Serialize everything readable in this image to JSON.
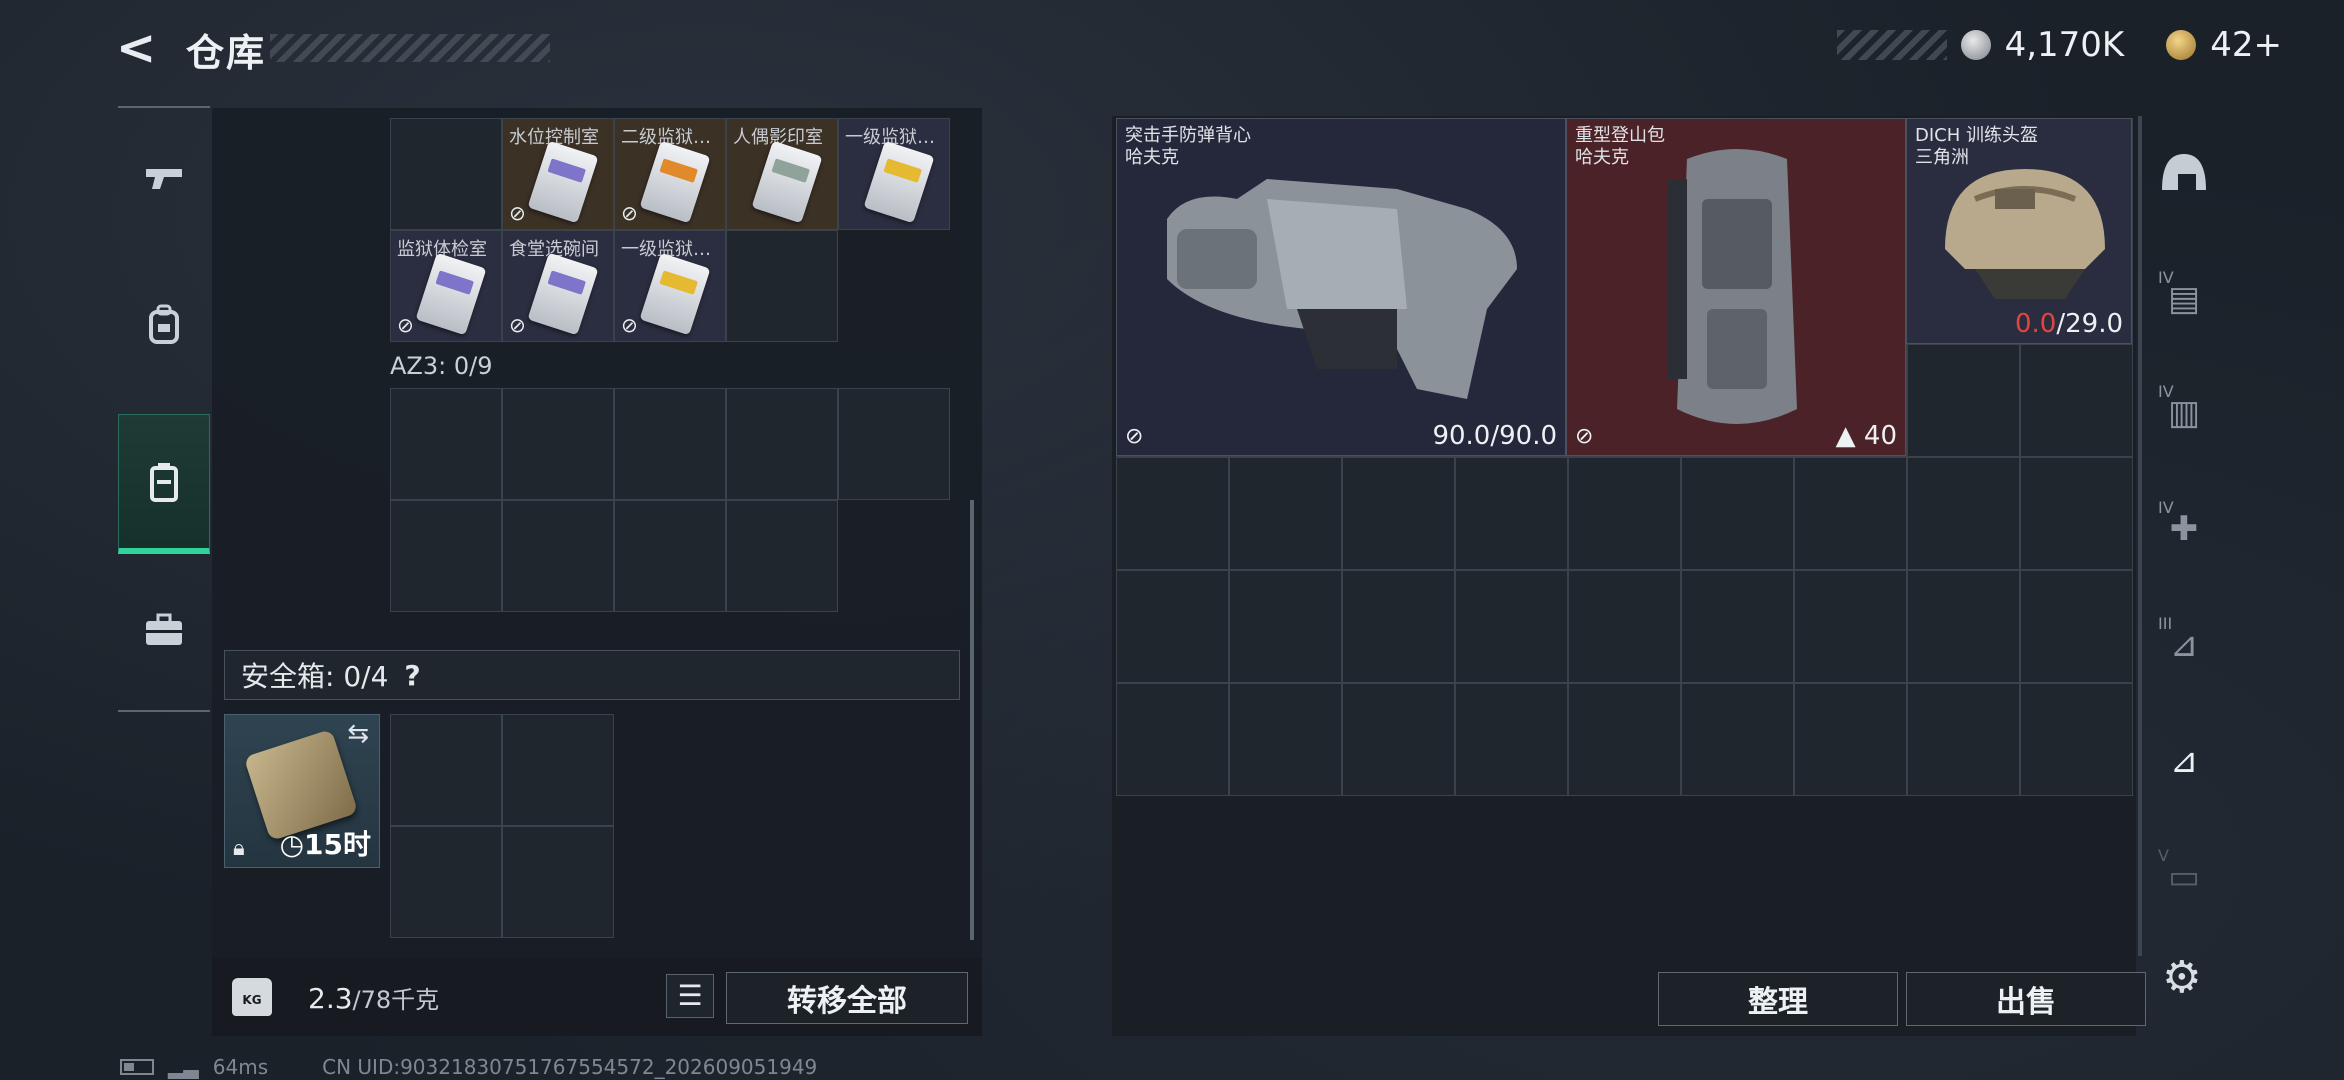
{
  "header": {
    "back_icon": "back-arrow-icon",
    "title": "仓库",
    "currency": [
      {
        "icon": "silver-coin-icon",
        "value": "4,170K"
      },
      {
        "icon": "gold-coin-icon",
        "value": "42+"
      }
    ]
  },
  "left_nav": [
    {
      "icon": "gun-icon",
      "glyph": "⌐"
    },
    {
      "icon": "backpack-icon",
      "glyph": "♜"
    },
    {
      "icon": "vest-icon",
      "glyph": "▣",
      "active": true
    },
    {
      "icon": "briefcase-icon",
      "glyph": "⬓"
    }
  ],
  "keycards": [
    {
      "label": "",
      "color": "none",
      "bg": "empty"
    },
    {
      "label": "水位控制室",
      "color": "purple",
      "bg": "brown"
    },
    {
      "label": "二级监狱…",
      "color": "orange",
      "bg": "brown"
    },
    {
      "label": "人偶影印室",
      "color": "green",
      "bg": "brown"
    },
    {
      "label": "一级监狱…",
      "color": "gold",
      "bg": "navy"
    },
    {
      "label": "监狱体检室",
      "color": "purple",
      "bg": "navy"
    },
    {
      "label": "食堂选碗间",
      "color": "purple",
      "bg": "navy"
    },
    {
      "label": "一级监狱…",
      "color": "gold",
      "bg": "navy"
    }
  ],
  "az3": {
    "label": "AZ3: 0/9"
  },
  "safe_box": {
    "label": "安全箱: 0/4",
    "help": "?",
    "time": "15时",
    "swap_icon": "swap-icon",
    "lock_icon": "lock-icon",
    "clock_icon": "clock-icon"
  },
  "bottom": {
    "weight_icon_text": "KG",
    "weight_value": "2.3",
    "weight_capacity": "/78千克",
    "list_icon": "list-icon",
    "transfer_all": "转移全部"
  },
  "equipment": [
    {
      "name": "突击手防弹背心",
      "brand": "哈夫克",
      "value": "90.0/90.0",
      "bg": "#25283b"
    },
    {
      "name": "重型登山包",
      "brand": "哈夫克",
      "value": "40",
      "bg": "#4a2227"
    },
    {
      "name": "DICH 训练头盔",
      "brand": "三角洲",
      "value_current": "0.0",
      "value_max": "/29.0",
      "bg": "#2a2d40"
    }
  ],
  "right_actions": {
    "organize": "整理",
    "sell": "出售"
  },
  "right_rail": [
    {
      "icon": "helmet-slot-icon",
      "tag": ""
    },
    {
      "icon": "iv-armor-icon",
      "tag": "IV"
    },
    {
      "icon": "iv-ammo-icon",
      "tag": "IV"
    },
    {
      "icon": "iv-medkit-icon",
      "tag": "IV"
    },
    {
      "icon": "iii-card-icon",
      "tag": "III"
    },
    {
      "icon": "keycard-active-icon",
      "tag": ""
    },
    {
      "icon": "v-cash-icon",
      "tag": "V"
    }
  ],
  "settings_icon": "gear-icon",
  "status": {
    "ping": "64ms",
    "uid": "CN UID:903218307517675545​72_202609051949"
  }
}
